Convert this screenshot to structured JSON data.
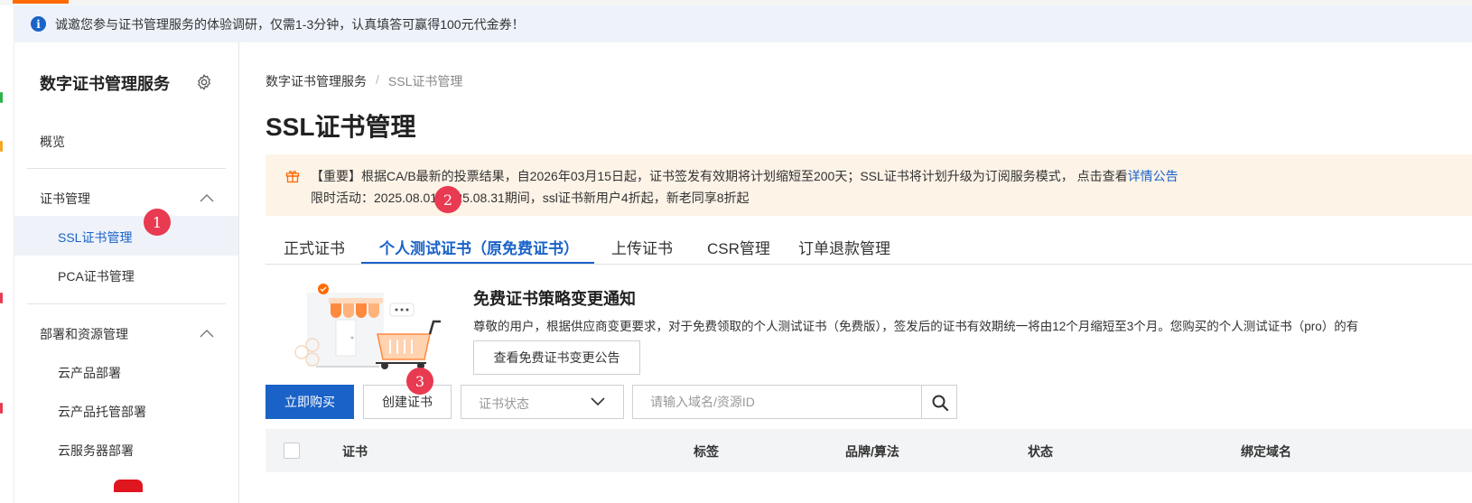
{
  "notice": {
    "text": "诚邀您参与证书管理服务的体验调研，仅需1-3分钟，认真填答可赢得100元代金券！"
  },
  "sidebar": {
    "title": "数字证书管理服务",
    "overview": "概览",
    "cert_group": "证书管理",
    "ssl_cert": "SSL证书管理",
    "pca_cert": "PCA证书管理",
    "deploy_group": "部署和资源管理",
    "cloud_deploy": "云产品部署",
    "cloud_hosted_deploy": "云产品托管部署",
    "server_deploy": "云服务器部署"
  },
  "breadcrumb": {
    "root": "数字证书管理服务",
    "sep": "/",
    "current": "SSL证书管理"
  },
  "page_title": "SSL证书管理",
  "announcement": {
    "line1_prefix": "【重要】根据CA/B最新的投票结果，自2026年03月15日起，证书签发有效期将计划缩短至200天；SSL证书将计划升级为订阅服务模式， 点击查看",
    "line1_link": "详情公告",
    "line2": "限时活动：2025.08.01-2025.08.31期间，ssl证书新用户4折起，新老同享8折起"
  },
  "tabs": [
    "正式证书",
    "个人测试证书（原免费证书）",
    "上传证书",
    "CSR管理",
    "订单退款管理"
  ],
  "promo": {
    "title": "免费证书策略变更通知",
    "desc": "尊敬的用户，根据供应商变更要求，对于免费领取的个人测试证书（免费版），签发后的证书有效期统一将由12个月缩短至3个月。您购买的个人测试证书（pro）的有",
    "button": "查看免费证书变更公告"
  },
  "toolbar": {
    "buy": "立即购买",
    "create": "创建证书",
    "status_placeholder": "证书状态",
    "search_placeholder": "请输入域名/资源ID"
  },
  "table": {
    "columns": [
      "证书",
      "标签",
      "品牌/算法",
      "状态",
      "绑定域名"
    ]
  },
  "markers": [
    "1",
    "2",
    "3"
  ],
  "colors": {
    "primary": "#1a62c8",
    "accent": "#ff6a00",
    "marker": "#e83a50",
    "announce_bg": "#fdf3e7"
  }
}
